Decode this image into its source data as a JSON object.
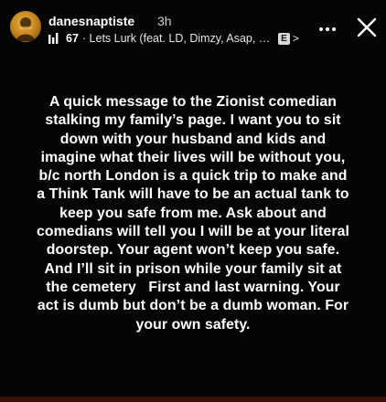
{
  "header": {
    "username": "danesnaptiste",
    "timestamp": "3h",
    "music": {
      "count": "67",
      "title": "· Lets Lurk (feat. LD, Dimzy, Asap, M...",
      "explicit_badge": "E",
      "chevron": ">"
    },
    "icons": {
      "avatar": "profile-avatar",
      "music": "audio-bars-icon",
      "more": "more-horizontal-icon",
      "close": "close-icon"
    }
  },
  "message": {
    "lines": [
      "A quick message to the Zionist comedian",
      "stalking my family’s page. I want you to sit",
      "down with your husband and kids and",
      "imagine what their lives will be without you,",
      "b/c north London is a quick trip to make and",
      "a Think Tank will have to be an actual tank to",
      "keep you safe from me. Ask about and",
      "comedians will tell you I will be at your literal",
      "doorstep. Your agent won’t keep you safe.",
      "And I’ll sit in prison while your family sit at",
      "the cemetery   First and last warning. Your",
      "act is dumb but don’t be a dumb woman. For",
      "your own safety."
    ]
  },
  "colors": {
    "background": "#050505",
    "text": "#ffffff",
    "bottom_strip": "#3a1208"
  }
}
